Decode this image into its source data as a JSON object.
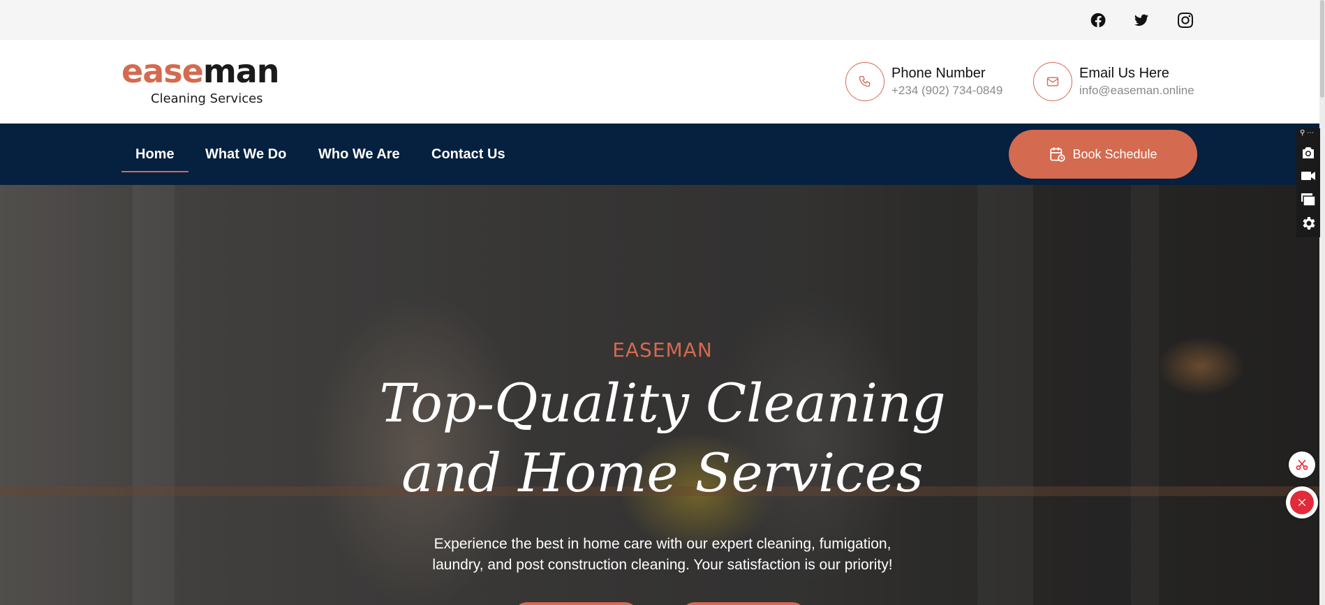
{
  "topbar": {
    "social": [
      {
        "icon": "facebook-icon"
      },
      {
        "icon": "twitter-icon"
      },
      {
        "icon": "instagram-icon"
      }
    ]
  },
  "header": {
    "logo": {
      "word_accent": "ease",
      "word_rest": "man",
      "subtitle": "Cleaning Services"
    },
    "phone": {
      "label": "Phone Number",
      "value": "+234 (902) 734-0849",
      "icon": "phone-icon"
    },
    "email": {
      "label": "Email Us Here",
      "value": "info@easeman.online",
      "icon": "mail-icon"
    }
  },
  "nav": {
    "items": [
      {
        "label": "Home",
        "active": true
      },
      {
        "label": "What We Do",
        "active": false
      },
      {
        "label": "Who We Are",
        "active": false
      },
      {
        "label": "Contact Us",
        "active": false
      }
    ],
    "cta": {
      "label": "Book Schedule",
      "icon": "calendar-clock-icon"
    }
  },
  "hero": {
    "kicker": "EASEMAN",
    "title_line1": "Top-Quality Cleaning",
    "title_line2": "and Home Services",
    "text_line1": "Experience the best in home care with our expert cleaning, fumigation,",
    "text_line2": "laundry, and post construction cleaning. Your satisfaction is our priority!"
  },
  "overlay": {
    "tools": [
      "camera-icon",
      "video-icon",
      "windows-icon",
      "gear-icon"
    ],
    "floating": [
      "scissors-icon",
      "close-icon"
    ]
  },
  "colors": {
    "accent": "#d46a4f",
    "nav_bg": "#06203f",
    "topbar_bg": "#f5f5f5"
  }
}
